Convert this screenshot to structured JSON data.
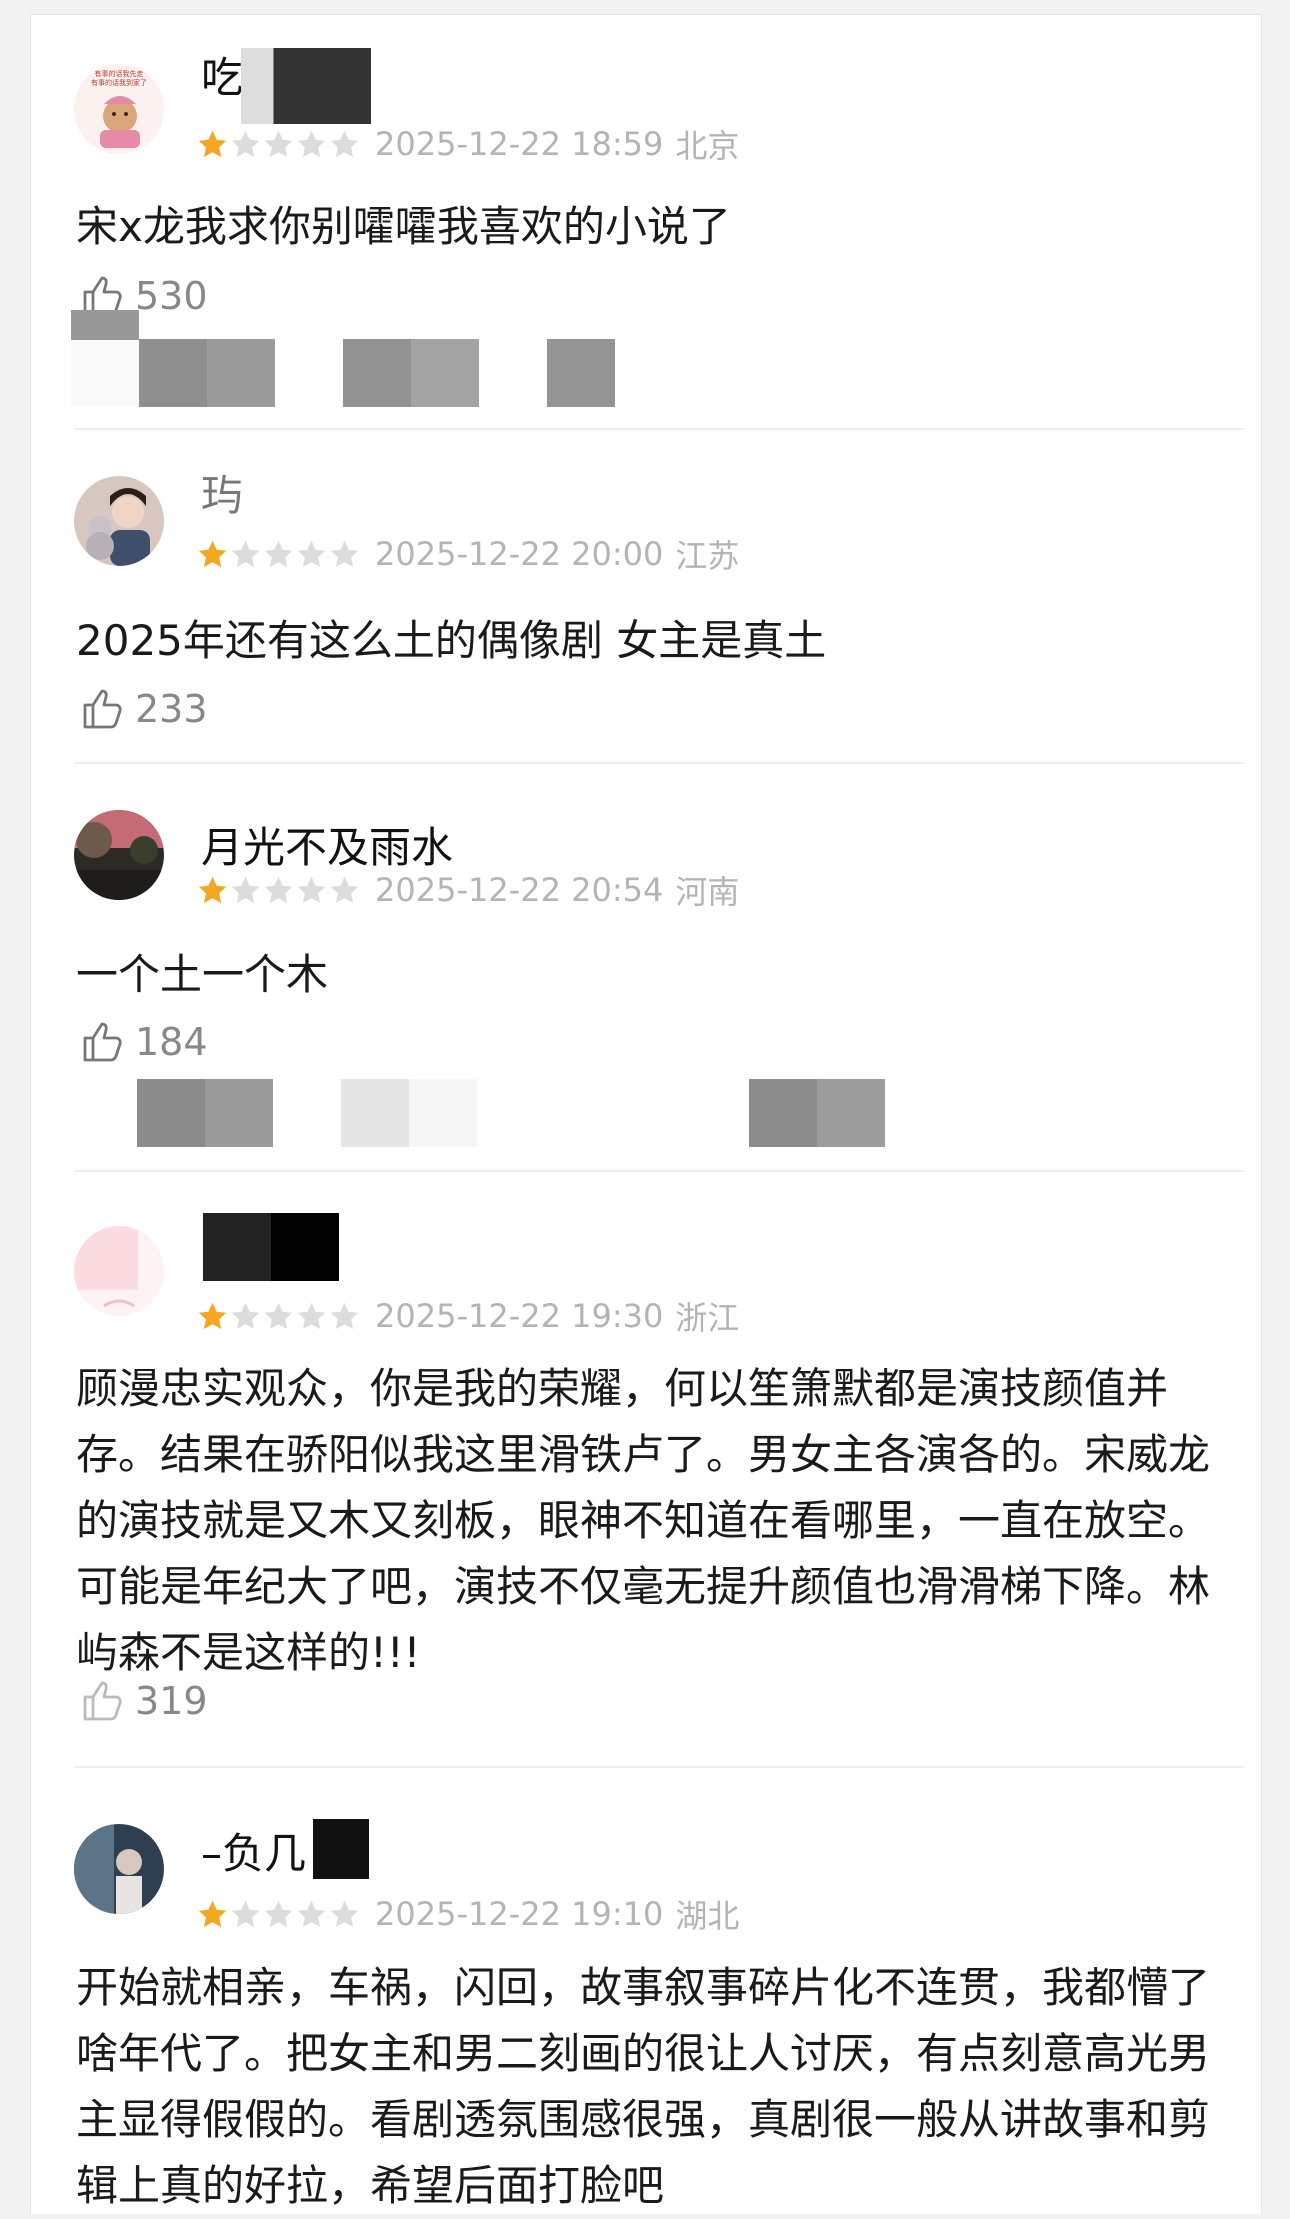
{
  "comments": [
    {
      "username": "吃",
      "avatar_text": "有事的话我先走\n有事的话我到家了",
      "time": "2025-12-22 18:59",
      "location": "北京",
      "rating": 1,
      "text": "宋x龙我求你别嚯嚯我喜欢的小说了",
      "likes": "530"
    },
    {
      "username": "玙",
      "time": "2025-12-22 20:00",
      "location": "江苏",
      "rating": 1,
      "text": "2025年还有这么土的偶像剧 女主是真土",
      "likes": "233"
    },
    {
      "username": "月光不及雨水",
      "time": "2025-12-22 20:54",
      "location": "河南",
      "rating": 1,
      "text": "一个土一个木",
      "likes": "184"
    },
    {
      "username": "",
      "time": "2025-12-22 19:30",
      "location": "浙江",
      "rating": 1,
      "text": "顾漫忠实观众，你是我的荣耀，何以笙箫默都是演技颜值并存。结果在骄阳似我这里滑铁卢了。男女主各演各的。宋威龙的演技就是又木又刻板，眼神不知道在看哪里，一直在放空。可能是年纪大了吧，演技不仅毫无提升颜值也滑滑梯下降。林屿森不是这样的!!!",
      "likes": "319"
    },
    {
      "username": "–负几",
      "time": "2025-12-22 19:10",
      "location": "湖北",
      "rating": 1,
      "text": "开始就相亲，车祸，闪回，故事叙事碎片化不连贯，我都懵了啥年代了。把女主和男二刻画的很让人讨厌，有点刻意高光男主显得假假的。看剧透氛围感很强，真剧很一般从讲故事和剪辑上真的好拉，希望后面打脸吧",
      "likes": ""
    }
  ],
  "colors": {
    "star_active": "#f5a623",
    "star_inactive": "#dcdcdc",
    "meta_text": "#b4b4b4"
  },
  "icons": {
    "star": "star-icon",
    "like": "thumb-up-icon"
  }
}
